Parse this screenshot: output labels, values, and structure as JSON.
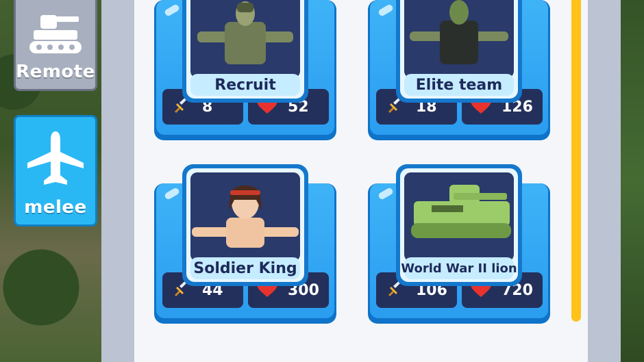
{
  "tabs": [
    {
      "label": "Remote",
      "icon": "tank-icon",
      "active": false
    },
    {
      "label": "melee",
      "icon": "airplane-icon",
      "active": true
    }
  ],
  "units": [
    {
      "name": "Recruit",
      "attack": "8",
      "hp": "52",
      "portrait": "soldier-camo"
    },
    {
      "name": "Elite team",
      "attack": "18",
      "hp": "126",
      "portrait": "soldier-dark"
    },
    {
      "name": "Soldier King",
      "attack": "44",
      "hp": "300",
      "portrait": "soldier-bandana"
    },
    {
      "name": "World War II lion",
      "attack": "106",
      "hp": "720",
      "portrait": "green-tank"
    }
  ],
  "icons": {
    "attack": "sword-icon",
    "hp": "heart-icon"
  },
  "colors": {
    "accent": "#2ab8f5",
    "scrollbar": "#ffc21a",
    "stat_bg": "#24305c",
    "heart": "#e8322e"
  }
}
